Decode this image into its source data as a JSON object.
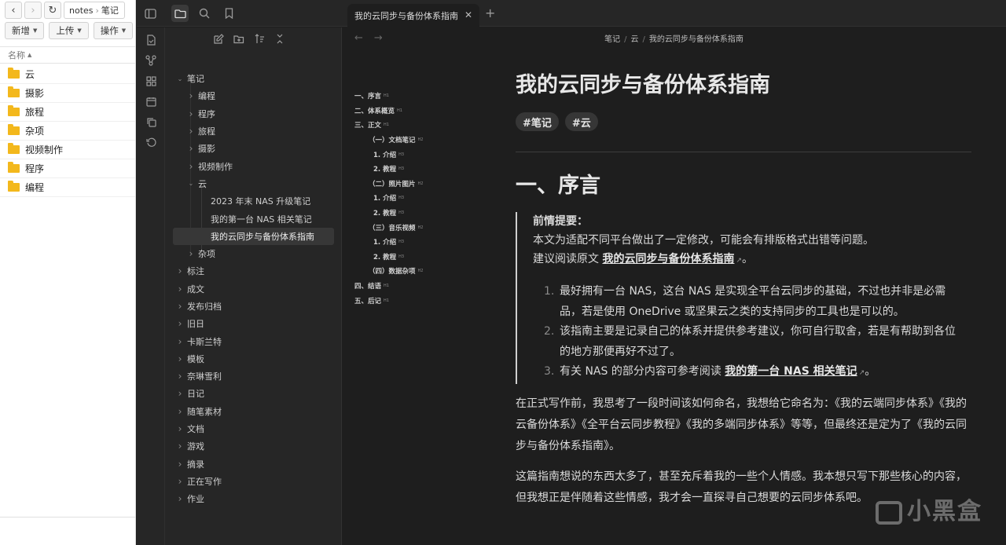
{
  "file_manager": {
    "path_root": "notes",
    "path_current": "笔记",
    "buttons": [
      "新增",
      "上传",
      "操作"
    ],
    "column_name": "名称",
    "folders": [
      "云",
      "摄影",
      "旅程",
      "杂项",
      "视频制作",
      "程序",
      "编程"
    ]
  },
  "tab": {
    "title": "我的云同步与备份体系指南"
  },
  "breadcrumb": [
    "笔记",
    "云",
    "我的云同步与备份体系指南"
  ],
  "tree": [
    {
      "label": "笔记",
      "level": 0,
      "open": true
    },
    {
      "label": "编程",
      "level": 1
    },
    {
      "label": "程序",
      "level": 1
    },
    {
      "label": "旅程",
      "level": 1
    },
    {
      "label": "摄影",
      "level": 1
    },
    {
      "label": "视频制作",
      "level": 1
    },
    {
      "label": "云",
      "level": 1,
      "open": true
    },
    {
      "label": "2023 年末 NAS 升级笔记",
      "level": 2
    },
    {
      "label": "我的第一台 NAS 相关笔记",
      "level": 2
    },
    {
      "label": "我的云同步与备份体系指南",
      "level": 2,
      "selected": true
    },
    {
      "label": "杂项",
      "level": 1
    },
    {
      "label": "标注",
      "level": 0
    },
    {
      "label": "成文",
      "level": 0
    },
    {
      "label": "发布归档",
      "level": 0
    },
    {
      "label": "旧日",
      "level": 0
    },
    {
      "label": "卡斯兰特",
      "level": 0
    },
    {
      "label": "模板",
      "level": 0
    },
    {
      "label": "奈琳雪利",
      "level": 0
    },
    {
      "label": "日记",
      "level": 0
    },
    {
      "label": "随笔素材",
      "level": 0
    },
    {
      "label": "文档",
      "level": 0
    },
    {
      "label": "游戏",
      "level": 0
    },
    {
      "label": "摘录",
      "level": 0
    },
    {
      "label": "正在写作",
      "level": 0
    },
    {
      "label": "作业",
      "level": 0
    }
  ],
  "toc": [
    {
      "text": "一、序言",
      "lv": "H1",
      "level": 1
    },
    {
      "text": "二、体系概览",
      "lv": "H1",
      "level": 1
    },
    {
      "text": "三、正文",
      "lv": "H1",
      "level": 1
    },
    {
      "text": "（一）文档笔记",
      "lv": "H2",
      "level": 2
    },
    {
      "text": "1. 介绍",
      "lv": "H3",
      "level": 3
    },
    {
      "text": "2. 教程",
      "lv": "H3",
      "level": 3
    },
    {
      "text": "（二）照片图片",
      "lv": "H2",
      "level": 2
    },
    {
      "text": "1. 介绍",
      "lv": "H3",
      "level": 3
    },
    {
      "text": "2. 教程",
      "lv": "H3",
      "level": 3
    },
    {
      "text": "（三）音乐视频",
      "lv": "H2",
      "level": 2
    },
    {
      "text": "1. 介绍",
      "lv": "H3",
      "level": 3
    },
    {
      "text": "2. 教程",
      "lv": "H3",
      "level": 3
    },
    {
      "text": "（四）数据杂项",
      "lv": "H2",
      "level": 2
    },
    {
      "text": "四、结语",
      "lv": "H1",
      "level": 1
    },
    {
      "text": "五、后记",
      "lv": "H1",
      "level": 1
    }
  ],
  "doc": {
    "title": "我的云同步与备份体系指南",
    "tags": [
      "#笔记",
      "#云"
    ],
    "h1": "一、序言",
    "quote_title": "前情提要：",
    "quote_line1": "本文为适配不同平台做出了一定修改，可能会有排版格式出错等问题。",
    "quote_line2_prefix": "建议阅读原文 ",
    "quote_link": "我的云同步与备份体系指南",
    "quote_line2_suffix": "。",
    "list": [
      {
        "num": "1.",
        "text": "最好拥有一台 NAS，这台 NAS 是实现全平台云同步的基础，不过也并非是必需品，若是使用 OneDrive 或坚果云之类的支持同步的工具也是可以的。"
      },
      {
        "num": "2.",
        "text": "该指南主要是记录自己的体系并提供参考建议，你可自行取舍，若是有帮助到各位的地方那便再好不过了。"
      },
      {
        "num": "3.",
        "text_prefix": "有关 NAS 的部分内容可参考阅读 ",
        "link": "我的第一台 NAS 相关笔记",
        "text_suffix": "。"
      }
    ],
    "p1": "在正式写作前，我思考了一段时间该如何命名，我想给它命名为：《我的云端同步体系》《我的云备份体系》《全平台云同步教程》《我的多端同步体系》等等，但最终还是定为了《我的云同步与备份体系指南》。",
    "p2": "这篇指南想说的东西太多了，甚至充斥着我的一些个人情感。我本想只写下那些核心的内容，但我想正是伴随着这些情感，我才会一直探寻自己想要的云同步体系吧。"
  },
  "watermark": "小黑盒"
}
